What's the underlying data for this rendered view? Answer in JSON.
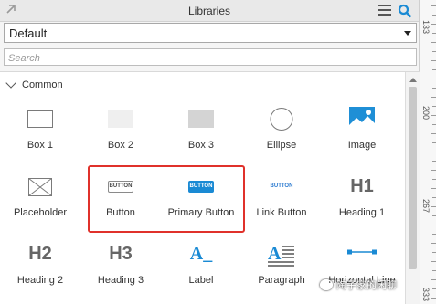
{
  "header": {
    "title": "Libraries"
  },
  "library_select": {
    "value": "Default"
  },
  "search": {
    "placeholder": "Search"
  },
  "section": {
    "title": "Common"
  },
  "items": [
    {
      "label": "Box 1"
    },
    {
      "label": "Box 2"
    },
    {
      "label": "Box 3"
    },
    {
      "label": "Ellipse"
    },
    {
      "label": "Image"
    },
    {
      "label": "Placeholder"
    },
    {
      "label": "Button",
      "preview_text": "BUTTON"
    },
    {
      "label": "Primary Button",
      "preview_text": "BUTTON"
    },
    {
      "label": "Link Button",
      "preview_text": "BUTTON"
    },
    {
      "label": "Heading 1",
      "preview_text": "H1"
    },
    {
      "label": "Heading 2",
      "preview_text": "H2"
    },
    {
      "label": "Heading 3",
      "preview_text": "H3"
    },
    {
      "label": "Label",
      "preview_text": "A_"
    },
    {
      "label": "Paragraph"
    },
    {
      "label": "Horizontal Line"
    }
  ],
  "ruler": {
    "marks": [
      "133",
      "200",
      "267",
      "333"
    ]
  },
  "watermark": {
    "text": "陶子家的闲聊"
  },
  "colors": {
    "primary_button": "#1a8ad4",
    "link": "#2b7ad0",
    "highlight": "#e0312b",
    "search_icon": "#1a8ad4"
  }
}
